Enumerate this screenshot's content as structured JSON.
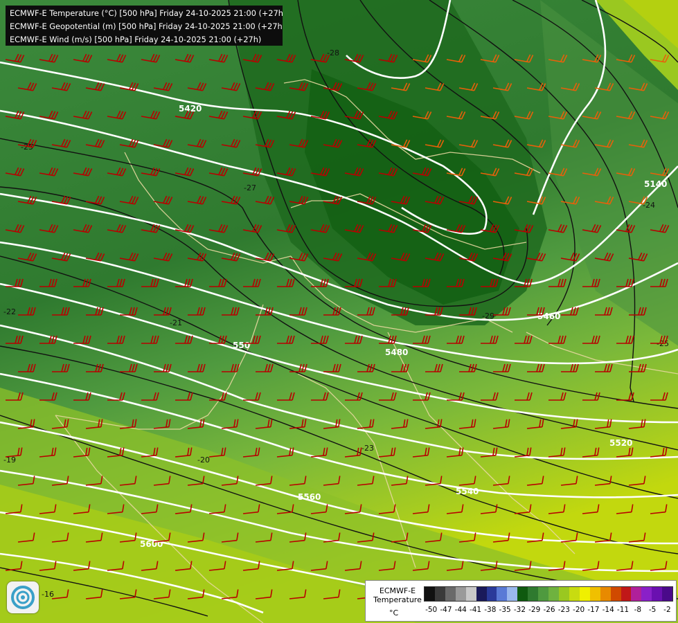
{
  "header": {
    "lines": [
      "ECMWF-E Temperature (°C) [500 hPa] Friday 24-10-2025 21:00 (+27h)",
      "ECMWF-E Geopotential (m) [500 hPa] Friday 24-10-2025 21:00 (+27h)",
      "ECMWF-E Wind (m/s) [500 hPa] Friday 24-10-2025 21:00 (+27h)"
    ]
  },
  "contour_labels": {
    "geopotential": [
      "5420",
      "5460",
      "5480",
      "550",
      "5520",
      "5540",
      "5560",
      "5600",
      "5140"
    ],
    "temperature": [
      "-25",
      "-27",
      "-28",
      "-29",
      "-21",
      "-22",
      "-20",
      "-23",
      "-19",
      "-16",
      "-24",
      "-25"
    ]
  },
  "legend": {
    "title": "ECMWF-E Temperature",
    "unit": "°C",
    "ticks": [
      "-50",
      "-47",
      "-44",
      "-41",
      "-38",
      "-35",
      "-32",
      "-29",
      "-26",
      "-23",
      "-20",
      "-17",
      "-14",
      "-11",
      "-8",
      "-5",
      "-2"
    ],
    "colors": [
      "#111111",
      "#3a3a3a",
      "#6a6a6a",
      "#9a9a9a",
      "#c9c9c9",
      "#1a1a5a",
      "#2a3a9a",
      "#5a7ad6",
      "#9ab8ee",
      "#0f5a0f",
      "#2f7a2f",
      "#4f9a3f",
      "#6fb23f",
      "#9ac820",
      "#c8dc10",
      "#f0f000",
      "#f0c000",
      "#e88a00",
      "#d04a00",
      "#c01818",
      "#b0209a",
      "#8a20c8",
      "#6a10b0",
      "#4a0a8a"
    ]
  },
  "colors": {
    "geopotential_contour": "#ffffff",
    "temperature_contour": "#111111",
    "wind_barb_strong": "#b80000",
    "wind_barb_moderate": "#e8600a",
    "border_line": "#e8d8a0"
  }
}
